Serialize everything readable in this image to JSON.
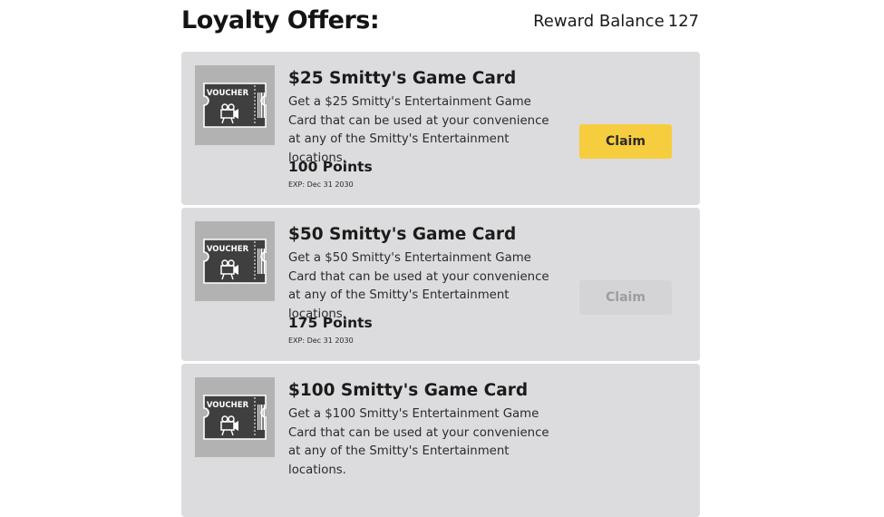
{
  "header": {
    "title": "Loyalty Offers:",
    "balance_label": "Reward Balance",
    "balance_value": "127"
  },
  "offers": [
    {
      "icon": "voucher-icon",
      "icon_text": "VOUCHER",
      "title": "$25 Smitty's Game Card",
      "description": "Get a $25 Smitty's Entertainment Game Card that can be used at your convenience at any of the Smitty's Entertainment locations.",
      "points": "100 Points",
      "expiry": "EXP: Dec 31 2030",
      "button_label": "Claim",
      "button_state": "enabled"
    },
    {
      "icon": "voucher-icon",
      "icon_text": "VOUCHER",
      "title": "$50 Smitty's Game Card",
      "description": "Get a $50 Smitty's Entertainment Game Card that can be used at your convenience at any of the Smitty's Entertainment locations.",
      "points": "175 Points",
      "expiry": "EXP: Dec 31 2030",
      "button_label": "Claim",
      "button_state": "disabled"
    },
    {
      "icon": "voucher-icon",
      "icon_text": "VOUCHER",
      "title": "$100 Smitty's Game Card",
      "description": "Get a $100 Smitty's Entertainment Game Card that can be used at your convenience at any of the Smitty's Entertainment locations."
    }
  ],
  "colors": {
    "card_background": "#dcdcde",
    "thumbnail_background": "#b2b2b2",
    "claim_active": "#f6cd3f",
    "claim_disabled": "#d4d4d6"
  }
}
